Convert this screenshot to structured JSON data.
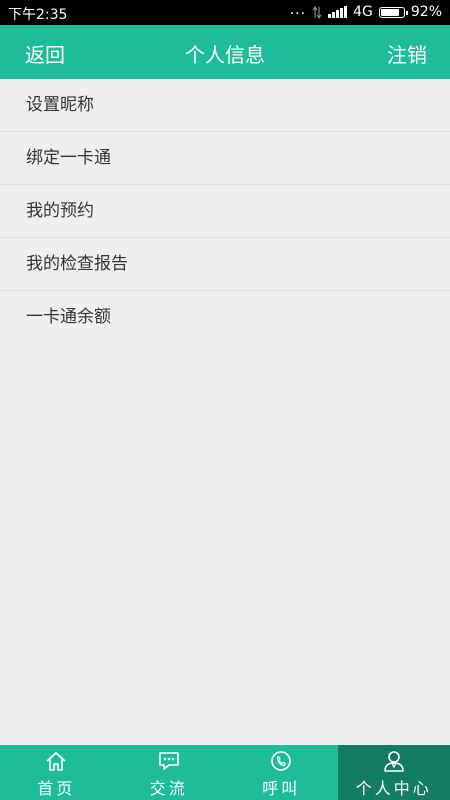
{
  "status_bar": {
    "time": "下午2:35",
    "dots": "...",
    "network": "4G",
    "battery_percent": "92%",
    "battery_level": 0.92,
    "icons": [
      "dots-icon",
      "data-transfer-icon",
      "signal-icon",
      "battery-icon"
    ]
  },
  "header": {
    "back_label": "返回",
    "title": "个人信息",
    "logout_label": "注销"
  },
  "menu": {
    "items": [
      {
        "label": "设置昵称"
      },
      {
        "label": "绑定一卡通"
      },
      {
        "label": "我的预约"
      },
      {
        "label": "我的检查报告"
      },
      {
        "label": "一卡通余额"
      }
    ]
  },
  "tabbar": {
    "tabs": [
      {
        "label": "首页",
        "icon": "home-icon"
      },
      {
        "label": "交流",
        "icon": "chat-bubble-icon"
      },
      {
        "label": "呼叫",
        "icon": "phone-icon"
      },
      {
        "label": "个人中心",
        "icon": "person-icon"
      }
    ],
    "active_index": 3
  },
  "colors": {
    "primary": "#1fbc99",
    "active_tab": "#127d64",
    "background": "#efefef"
  }
}
